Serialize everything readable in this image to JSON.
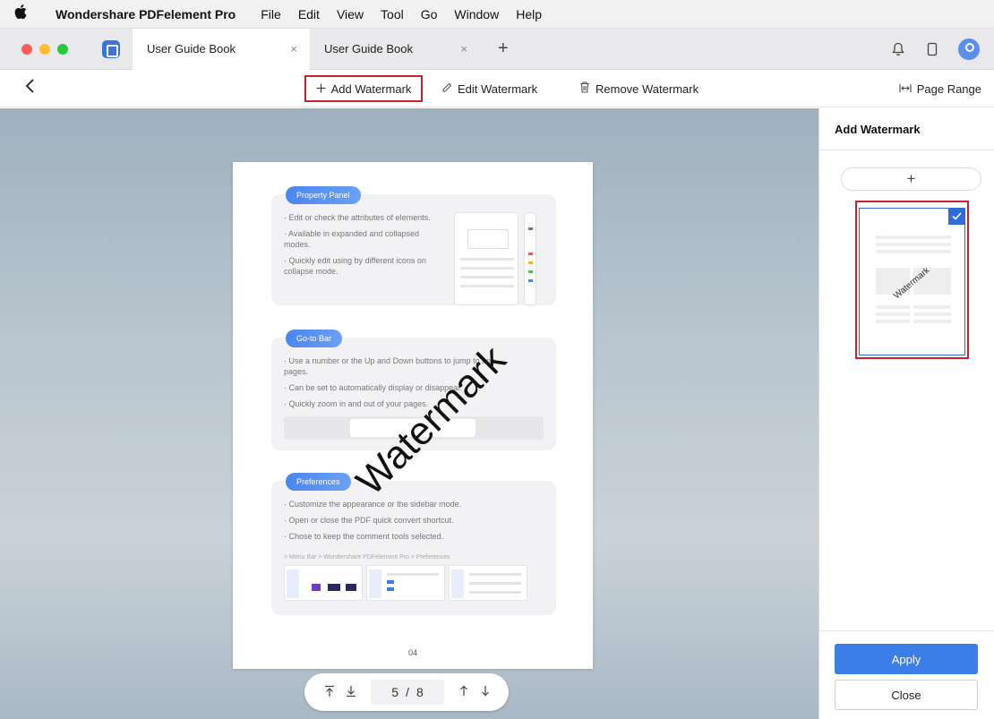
{
  "menubar": {
    "app_name": "Wondershare PDFelement Pro",
    "items": [
      "File",
      "Edit",
      "View",
      "Tool",
      "Go",
      "Window",
      "Help"
    ]
  },
  "tabs": [
    {
      "label": "User Guide Book",
      "active": true
    },
    {
      "label": "User Guide Book",
      "active": false
    }
  ],
  "tab_close_glyph": "×",
  "new_tab_glyph": "+",
  "toolbar": {
    "add_watermark": "Add Watermark",
    "edit_watermark": "Edit Watermark",
    "remove_watermark": "Remove Watermark",
    "page_range": "Page Range"
  },
  "document": {
    "sections": [
      {
        "title": "Property Panel",
        "bullets": [
          "Edit or check the attributes of elements.",
          "Available in expanded and collapsed modes.",
          "Quickly edit using by different icons on collapse mode."
        ]
      },
      {
        "title": "Go-to Bar",
        "bullets": [
          "Use a number or the Up and Down buttons to jump to any pages.",
          "Can be set to automatically display or disappear.",
          "Quickly zoom in and out of your pages."
        ]
      },
      {
        "title": "Preferences",
        "bullets": [
          "Customize the appearance or the sidebar mode.",
          "Open or close the PDF quick convert shortcut.",
          "Chose to keep the comment tools selected."
        ],
        "path": "> Menu Bar  > Wondershare PDFelement Pro  > Preferences"
      }
    ],
    "page_number": "04",
    "watermark_text": "Watermark"
  },
  "page_nav": {
    "current": "5",
    "separator": "/",
    "total": "8"
  },
  "right_panel": {
    "title": "Add Watermark",
    "add_glyph": "+",
    "template_watermark": "Watermark",
    "apply_label": "Apply",
    "close_label": "Close"
  },
  "colors": {
    "accent": "#3b7ee8",
    "highlight_border": "#c8202f",
    "traffic_red": "#fe5f57",
    "traffic_yellow": "#febc2e",
    "traffic_green": "#28c840"
  }
}
